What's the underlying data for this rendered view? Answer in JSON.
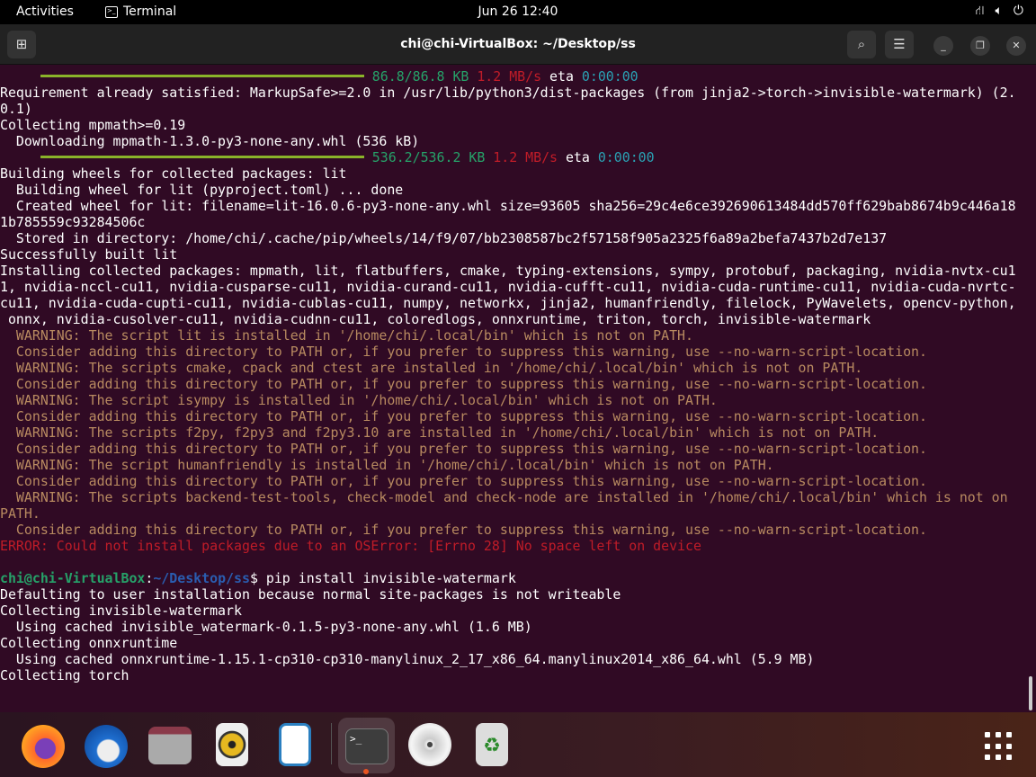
{
  "topbar": {
    "activities": "Activities",
    "app_name": "Terminal",
    "clock": "Jun 26  12:40"
  },
  "window": {
    "title": "chi@chi-VirtualBox: ~/Desktop/ss"
  },
  "colors": {
    "background": "#300a24",
    "accent": "#e95420"
  },
  "terminal": {
    "rows": [
      [
        [
          "     ",
          ""
        ],
        [
          "BAR",
          "bar"
        ],
        [
          " 86.8/86.8 KB",
          "c-green"
        ],
        [
          " 1.2 MB/s",
          "c-red"
        ],
        [
          " eta ",
          ""
        ],
        [
          "0:00:00",
          "c-cyan"
        ]
      ],
      [
        [
          "Requirement already satisfied: MarkupSafe>=2.0 in /usr/lib/python3/dist-packages (from jinja2->torch->invisible-watermark) (2.",
          ""
        ]
      ],
      [
        [
          "0.1)",
          ""
        ]
      ],
      [
        [
          "Collecting mpmath>=0.19",
          ""
        ]
      ],
      [
        [
          "  Downloading mpmath-1.3.0-py3-none-any.whl (536 kB)",
          ""
        ]
      ],
      [
        [
          "     ",
          ""
        ],
        [
          "BAR",
          "bar"
        ],
        [
          " 536.2/536.2 KB",
          "c-green"
        ],
        [
          " 1.2 MB/s",
          "c-red"
        ],
        [
          " eta ",
          ""
        ],
        [
          "0:00:00",
          "c-cyan"
        ]
      ],
      [
        [
          "Building wheels for collected packages: lit",
          ""
        ]
      ],
      [
        [
          "  Building wheel for lit (pyproject.toml) ... done",
          ""
        ]
      ],
      [
        [
          "  Created wheel for lit: filename=lit-16.0.6-py3-none-any.whl size=93605 sha256=29c4e6ce392690613484dd570ff629bab8674b9c446a18",
          ""
        ]
      ],
      [
        [
          "1b785559c93284506c",
          ""
        ]
      ],
      [
        [
          "  Stored in directory: /home/chi/.cache/pip/wheels/14/f9/07/bb2308587bc2f57158f905a2325f6a89a2befa7437b2d7e137",
          ""
        ]
      ],
      [
        [
          "Successfully built lit",
          ""
        ]
      ],
      [
        [
          "Installing collected packages: mpmath, lit, flatbuffers, cmake, typing-extensions, sympy, protobuf, packaging, nvidia-nvtx-cu1",
          ""
        ]
      ],
      [
        [
          "1, nvidia-nccl-cu11, nvidia-cusparse-cu11, nvidia-curand-cu11, nvidia-cufft-cu11, nvidia-cuda-runtime-cu11, nvidia-cuda-nvrtc-",
          ""
        ]
      ],
      [
        [
          "cu11, nvidia-cuda-cupti-cu11, nvidia-cublas-cu11, numpy, networkx, jinja2, humanfriendly, filelock, PyWavelets, opencv-python,",
          ""
        ]
      ],
      [
        [
          " onnx, nvidia-cusolver-cu11, nvidia-cudnn-cu11, coloredlogs, onnxruntime, triton, torch, invisible-watermark",
          ""
        ]
      ],
      [
        [
          "  WARNING: The script lit is installed in '/home/chi/.local/bin' which is not on PATH.",
          "c-warn"
        ]
      ],
      [
        [
          "  Consider adding this directory to PATH or, if you prefer to suppress this warning, use --no-warn-script-location.",
          "c-warn"
        ]
      ],
      [
        [
          "  WARNING: The scripts cmake, cpack and ctest are installed in '/home/chi/.local/bin' which is not on PATH.",
          "c-warn"
        ]
      ],
      [
        [
          "  Consider adding this directory to PATH or, if you prefer to suppress this warning, use --no-warn-script-location.",
          "c-warn"
        ]
      ],
      [
        [
          "  WARNING: The script isympy is installed in '/home/chi/.local/bin' which is not on PATH.",
          "c-warn"
        ]
      ],
      [
        [
          "  Consider adding this directory to PATH or, if you prefer to suppress this warning, use --no-warn-script-location.",
          "c-warn"
        ]
      ],
      [
        [
          "  WARNING: The scripts f2py, f2py3 and f2py3.10 are installed in '/home/chi/.local/bin' which is not on PATH.",
          "c-warn"
        ]
      ],
      [
        [
          "  Consider adding this directory to PATH or, if you prefer to suppress this warning, use --no-warn-script-location.",
          "c-warn"
        ]
      ],
      [
        [
          "  WARNING: The script humanfriendly is installed in '/home/chi/.local/bin' which is not on PATH.",
          "c-warn"
        ]
      ],
      [
        [
          "  Consider adding this directory to PATH or, if you prefer to suppress this warning, use --no-warn-script-location.",
          "c-warn"
        ]
      ],
      [
        [
          "  WARNING: The scripts backend-test-tools, check-model and check-node are installed in '/home/chi/.local/bin' which is not on",
          "c-warn"
        ]
      ],
      [
        [
          "PATH.",
          "c-warn"
        ]
      ],
      [
        [
          "  Consider adding this directory to PATH or, if you prefer to suppress this warning, use --no-warn-script-location.",
          "c-warn"
        ]
      ],
      [
        [
          "ERROR: Could not install packages due to an OSError: [Errno 28] No space left on device",
          "c-err"
        ]
      ],
      [
        [
          "",
          ""
        ]
      ],
      [
        [
          "chi@chi-VirtualBox",
          "c-prompt"
        ],
        [
          ":",
          ""
        ],
        [
          "~/Desktop/ss",
          "c-path"
        ],
        [
          "$ pip install invisible-watermark",
          ""
        ]
      ],
      [
        [
          "Defaulting to user installation because normal site-packages is not writeable",
          ""
        ]
      ],
      [
        [
          "Collecting invisible-watermark",
          ""
        ]
      ],
      [
        [
          "  Using cached invisible_watermark-0.1.5-py3-none-any.whl (1.6 MB)",
          ""
        ]
      ],
      [
        [
          "Collecting onnxruntime",
          ""
        ]
      ],
      [
        [
          "  Using cached onnxruntime-1.15.1-cp310-cp310-manylinux_2_17_x86_64.manylinux2014_x86_64.whl (5.9 MB)",
          ""
        ]
      ],
      [
        [
          "Collecting torch",
          ""
        ]
      ]
    ]
  },
  "dock": {
    "apps": [
      "firefox",
      "thunderbird",
      "files",
      "rhythmbox",
      "libreoffice-writer",
      "terminal",
      "disc",
      "trash"
    ]
  }
}
